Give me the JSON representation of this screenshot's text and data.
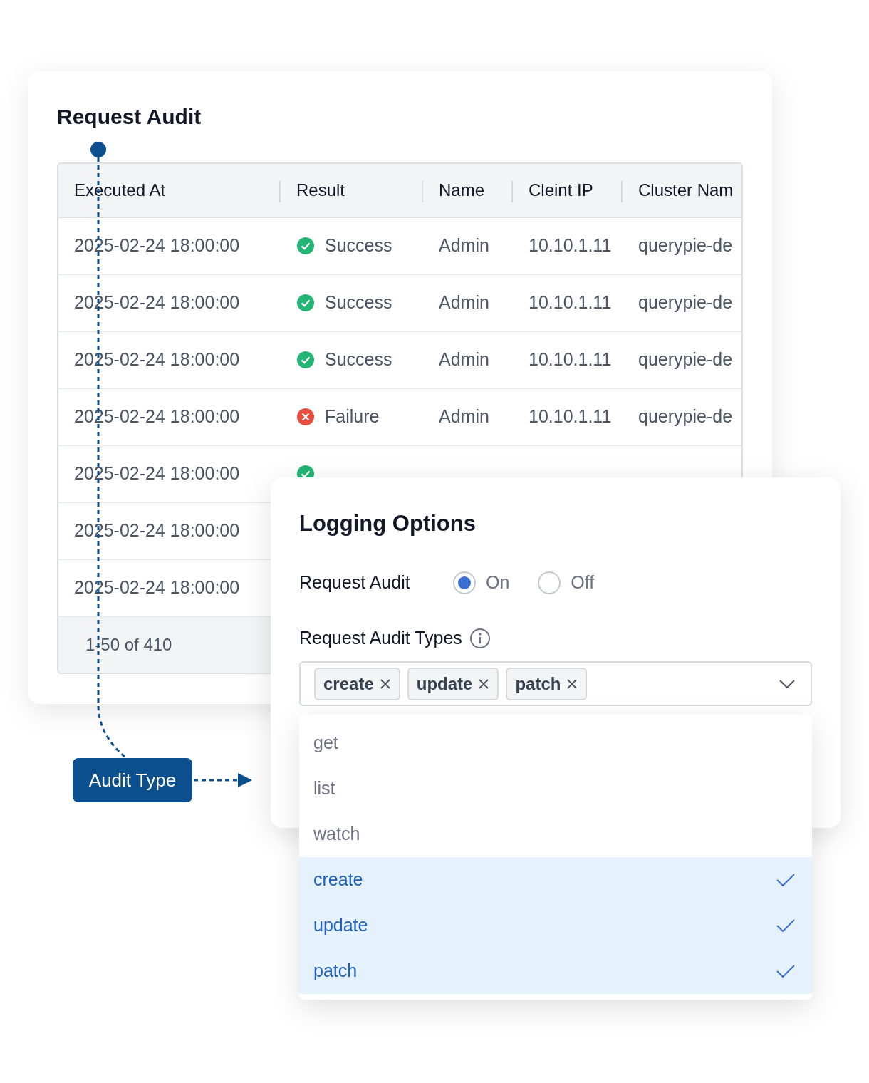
{
  "table_card": {
    "title": "Request Audit",
    "columns": [
      "Executed At",
      "Result",
      "Name",
      "Cleint IP",
      "Cluster Nam"
    ],
    "rows": [
      {
        "executed_at": "2025-02-24 18:00:00",
        "result": {
          "kind": "success",
          "label": "Success"
        },
        "name": "Admin",
        "client_ip": "10.10.1.11",
        "cluster": "querypie-de"
      },
      {
        "executed_at": "2025-02-24 18:00:00",
        "result": {
          "kind": "success",
          "label": "Success"
        },
        "name": "Admin",
        "client_ip": "10.10.1.11",
        "cluster": "querypie-de"
      },
      {
        "executed_at": "2025-02-24 18:00:00",
        "result": {
          "kind": "success",
          "label": "Success"
        },
        "name": "Admin",
        "client_ip": "10.10.1.11",
        "cluster": "querypie-de"
      },
      {
        "executed_at": "2025-02-24 18:00:00",
        "result": {
          "kind": "failure",
          "label": "Failure"
        },
        "name": "Admin",
        "client_ip": "10.10.1.11",
        "cluster": "querypie-de"
      },
      {
        "executed_at": "2025-02-24 18:00:00",
        "result": {
          "kind": "success"
        }
      },
      {
        "executed_at": "2025-02-24 18:00:00"
      },
      {
        "executed_at": "2025-02-24 18:00:00"
      }
    ],
    "pagination": "1-50 of 410"
  },
  "callout": {
    "label": "Audit Type"
  },
  "logging_options": {
    "title": "Logging Options",
    "request_audit": {
      "label": "Request Audit",
      "options": [
        {
          "label": "On",
          "selected": true
        },
        {
          "label": "Off",
          "selected": false
        }
      ]
    },
    "audit_types": {
      "label": "Request Audit Types",
      "tags": [
        "create",
        "update",
        "patch"
      ],
      "options": [
        {
          "label": "get",
          "selected": false
        },
        {
          "label": "list",
          "selected": false
        },
        {
          "label": "watch",
          "selected": false
        },
        {
          "label": "create",
          "selected": true
        },
        {
          "label": "update",
          "selected": true
        },
        {
          "label": "patch",
          "selected": true
        }
      ]
    }
  }
}
